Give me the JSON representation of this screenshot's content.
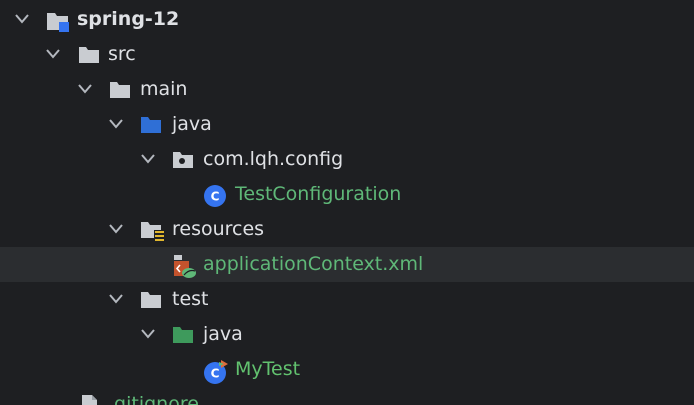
{
  "tree": {
    "items": [
      {
        "label": "spring-12",
        "icon": "module-folder-icon",
        "expanded": true
      },
      {
        "label": "src",
        "icon": "folder-icon",
        "expanded": true
      },
      {
        "label": "main",
        "icon": "folder-icon",
        "expanded": true
      },
      {
        "label": "java",
        "icon": "source-root-folder-icon",
        "expanded": true
      },
      {
        "label": "com.lqh.config",
        "icon": "package-icon",
        "expanded": true
      },
      {
        "label": "TestConfiguration",
        "icon": "class-icon"
      },
      {
        "label": "resources",
        "icon": "resources-folder-icon",
        "expanded": true
      },
      {
        "label": "applicationContext.xml",
        "icon": "spring-xml-icon",
        "selected": true
      },
      {
        "label": "test",
        "icon": "folder-icon",
        "expanded": true
      },
      {
        "label": "java",
        "icon": "test-root-folder-icon",
        "expanded": true
      },
      {
        "label": "MyTest",
        "icon": "test-class-icon"
      },
      {
        "label": ".gitignore",
        "icon": "file-icon"
      }
    ]
  },
  "colors": {
    "background": "#1e1f22",
    "selected_row": "#2b2d30",
    "text": "#dfe1e5",
    "vcs_added_green": "#5fb878",
    "source_root_blue": "#2f6fd6",
    "test_root_green": "#3e9a5c",
    "class_icon_blue": "#3574f0"
  }
}
